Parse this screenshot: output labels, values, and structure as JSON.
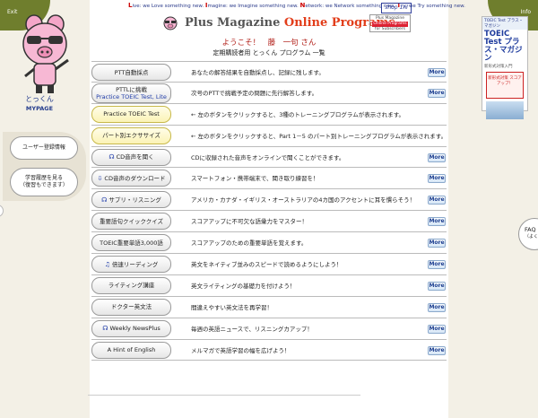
{
  "corners": {
    "exit_label": "Exit",
    "info_label": "Info"
  },
  "header": {
    "tagline": [
      {
        "cap": "L",
        "text": "ive:  we Love something new. "
      },
      {
        "cap": "I",
        "text": "magine:  we Imagine something new. "
      },
      {
        "cap": "N",
        "text": "etwork:  we Network something new. "
      },
      {
        "cap": "T",
        "text": "ry:  we Try something new."
      }
    ],
    "shop_label": "shop 1nl",
    "title_plain": "Plus Magazine ",
    "title_highlight": "Online Programs",
    "badge": {
      "line1": "Plus Magazine",
      "line2": "Online Programs",
      "line3": "for Subscribers"
    }
  },
  "welcome": "ようこそ！　藤　一句 さん",
  "subtitle": "定期購読者用 とっくん プログラム 一覧",
  "mascot": {
    "name": "とっくん",
    "subname": "MYPAGE"
  },
  "side_menu": {
    "user_info": "ユーザー登録情報",
    "history_line1": "学習履歴を見る",
    "history_line2": "（復習もできます）"
  },
  "more_label": "More",
  "programs": [
    {
      "label": "PTT自動採点",
      "label2": "",
      "desc": "あなたの解答結果を自動採点し、記録に残します。",
      "style": "white",
      "icon": "",
      "more": true
    },
    {
      "label": "PTTLに挑戦",
      "label2": "Practice TOEIC Test, Lite",
      "desc": "次号のPTTで挑戦予定の問題に先行解答します。",
      "style": "white",
      "icon": "",
      "more": true
    },
    {
      "label": "Practice TOEIC Test",
      "label2": "",
      "desc": "← 左のボタンをクリックすると、3種のトレーニングプログラムが表示されます。",
      "style": "yellow",
      "icon": "",
      "more": false
    },
    {
      "label": "パート別エクササイズ",
      "label2": "",
      "desc": "← 左のボタンをクリックすると、Part 1－5 のパート別トレーニングプログラムが表示されます。",
      "style": "yellow",
      "icon": "",
      "more": false
    },
    {
      "label": "CD音声を聞く",
      "label2": "",
      "desc": "CDに収録された音声をオンラインで聞くことができます。",
      "style": "white",
      "icon": "headphones-icon",
      "more": true
    },
    {
      "label": "CD音声のダウンロード",
      "label2": "",
      "desc": "スマートフォン・携帯端末で、聞き取り練習を！",
      "style": "white",
      "icon": "download-icon",
      "more": true
    },
    {
      "label": "サプリ・リスニング",
      "label2": "",
      "desc": "アメリカ・カナダ・イギリス・オーストラリアの4カ国のアクセントに耳を慣らそう！",
      "style": "white",
      "icon": "headphones-icon",
      "more": true
    },
    {
      "label": "重要語句クイッククイズ",
      "label2": "",
      "desc": "スコアアップに不可欠な語彙力をマスター！",
      "style": "white",
      "icon": "",
      "more": true
    },
    {
      "label": "TOEIC重要単語3,000語",
      "label2": "",
      "desc": "スコアアップのための重要単語を覚えます。",
      "style": "white",
      "icon": "",
      "more": true
    },
    {
      "label": "倍速リーディング",
      "label2": "",
      "desc": "英文をネイティブ並みのスピードで読めるようにしよう！",
      "style": "white",
      "icon": "music-icon",
      "more": true
    },
    {
      "label": "ライティング講座",
      "label2": "",
      "desc": "英文ライティングの基礎力を付けよう！",
      "style": "white",
      "icon": "",
      "more": true
    },
    {
      "label": "ドクター英文法",
      "label2": "",
      "desc": "間違えやすい英文法を再学習！",
      "style": "white",
      "icon": "",
      "more": true
    },
    {
      "label": "Weekly NewsPlus",
      "label2": "",
      "desc": "毎週の英語ニュースで、リスニングカアップ！",
      "style": "white",
      "icon": "headphones-icon",
      "more": true
    },
    {
      "label": "A Hint of English",
      "label2": "",
      "desc": "メルマガで英語学習の幅を広げよう！",
      "style": "white",
      "icon": "",
      "more": true
    }
  ],
  "magazine": {
    "band": "TOEIC Test プラス・マガジン",
    "title": "TOEIC Test プラス・マガジン",
    "small": "新形式対策入門",
    "red_box": "新形式対策 スコアアップ！"
  },
  "faq": {
    "label": "FAQ",
    "sub": "（よくある"
  }
}
